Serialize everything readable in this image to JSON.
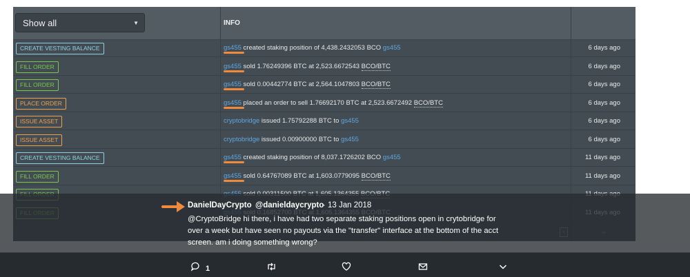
{
  "filter": {
    "value": "Show all"
  },
  "table": {
    "info_header": "INFO",
    "rows": [
      {
        "type": "CREATE VESTING BALANCE",
        "style": "vest",
        "parts": [
          {
            "t": "gs455",
            "k": "acct"
          },
          {
            "t": " created staking position of 4,438.2432053 BCO ",
            "k": "plain"
          },
          {
            "t": "gs455",
            "k": "acct"
          }
        ],
        "time": "6 days ago"
      },
      {
        "type": "FILL ORDER",
        "style": "fill",
        "parts": [
          {
            "t": "gs455",
            "k": "acct"
          },
          {
            "t": " sold 1.76249396 BTC at 2,523.6672543 ",
            "k": "plain"
          },
          {
            "t": "BCO/BTC",
            "k": "underl"
          }
        ],
        "time": "6 days ago"
      },
      {
        "type": "FILL ORDER",
        "style": "fill",
        "parts": [
          {
            "t": "gs455",
            "k": "acct"
          },
          {
            "t": " sold 0.00442774 BTC at 2,564.1047803 ",
            "k": "plain"
          },
          {
            "t": "BCO/BTC",
            "k": "underl"
          }
        ],
        "time": "6 days ago"
      },
      {
        "type": "PLACE ORDER",
        "style": "place",
        "parts": [
          {
            "t": "gs455",
            "k": "acct"
          },
          {
            "t": " placed an order to sell 1.76692170 BTC at 2,523.6672492 ",
            "k": "plain"
          },
          {
            "t": "BCO/BTC",
            "k": "underl"
          }
        ],
        "time": "6 days ago"
      },
      {
        "type": "ISSUE ASSET",
        "style": "issue",
        "parts": [
          {
            "t": "cryptobridge",
            "k": "acct"
          },
          {
            "t": " issued 1.75792288 BTC to ",
            "k": "plain"
          },
          {
            "t": "gs455",
            "k": "acct"
          }
        ],
        "time": "6 days ago"
      },
      {
        "type": "ISSUE ASSET",
        "style": "issue",
        "parts": [
          {
            "t": "cryptobridge",
            "k": "acct"
          },
          {
            "t": " issued 0.00900000 BTC to ",
            "k": "plain"
          },
          {
            "t": "gs455",
            "k": "acct"
          }
        ],
        "time": "6 days ago"
      },
      {
        "type": "CREATE VESTING BALANCE",
        "style": "vest",
        "parts": [
          {
            "t": "gs455",
            "k": "acct"
          },
          {
            "t": " created staking position of 8,037.1726202 BCO ",
            "k": "plain"
          },
          {
            "t": "gs455",
            "k": "acct"
          }
        ],
        "time": "11 days ago"
      },
      {
        "type": "FILL ORDER",
        "style": "fill",
        "parts": [
          {
            "t": "gs455",
            "k": "acct"
          },
          {
            "t": " sold 0.64767089 BTC at 1,603.0779095 ",
            "k": "plain"
          },
          {
            "t": "BCO/BTC",
            "k": "underl"
          }
        ],
        "time": "11 days ago"
      },
      {
        "type": "FILL ORDER",
        "style": "fill",
        "parts": [
          {
            "t": "gs455",
            "k": "acct"
          },
          {
            "t": " sold 0.00311500 BTC at 1,605.1364355 ",
            "k": "plain"
          },
          {
            "t": "BCO/BTC",
            "k": "underl"
          }
        ],
        "time": "11 days ago"
      },
      {
        "type": "FILL ORDER",
        "style": "fill",
        "parts": [
          {
            "t": "gs455",
            "k": "acct"
          },
          {
            "t": " sold 0.16852700 BTC at 1,605.1364355 ",
            "k": "plain"
          },
          {
            "t": "BCO/BTC",
            "k": "underl"
          }
        ],
        "time": "11 days ago"
      }
    ],
    "highlighted_rows": [
      0,
      1,
      2,
      3,
      6,
      7
    ]
  },
  "tweet": {
    "name": "DanielDayCrypto",
    "handle": "@danieldaycrypto",
    "date": "· 13 Jan 2018",
    "body": "@CryptoBridge hi there, i have had two separate staking positions open in crytobridge for over a week but have seen no payouts via the \"transfer\" interface at the bottom of the acct screen. am i doing something wrong?",
    "reply_count": "1"
  },
  "colors": {
    "accent_orange": "#f08a3c",
    "account_link": "#5fa7e2",
    "vest_badge": "#8fd0e2",
    "fill_badge": "#79c84a",
    "place_badge": "#f1a04a"
  },
  "icons": [
    "chevron-down-icon",
    "excel-icon",
    "expand-icon",
    "reply-icon",
    "retweet-icon",
    "like-icon",
    "message-icon",
    "more-icon"
  ]
}
